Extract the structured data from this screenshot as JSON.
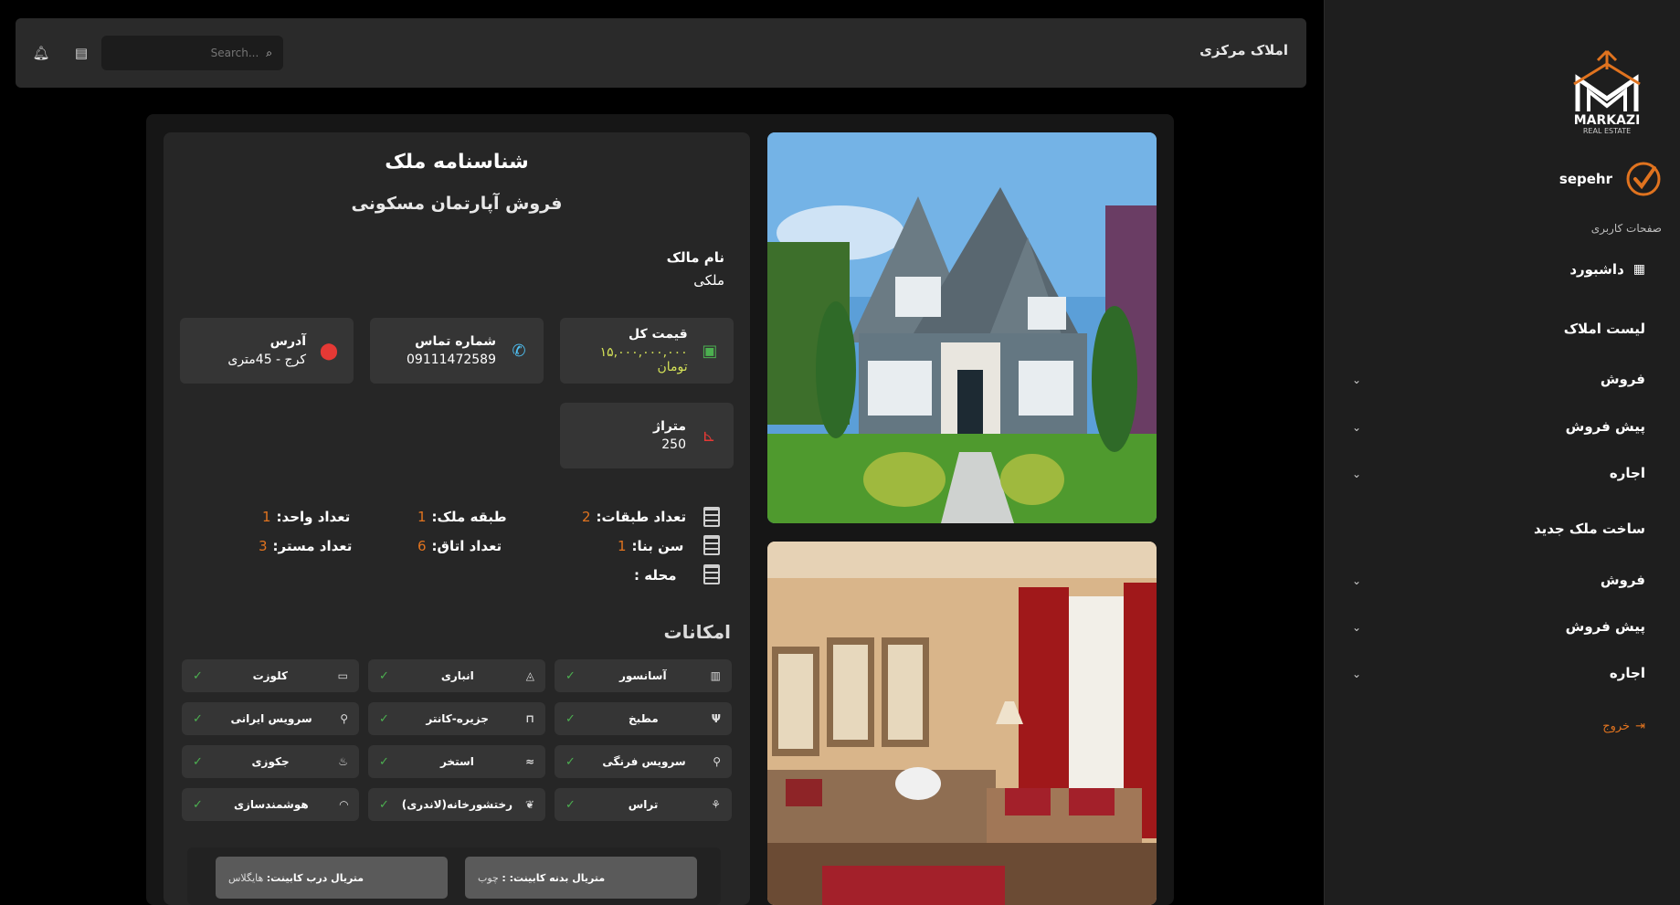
{
  "app": {
    "title": "املاک مرکزی"
  },
  "search": {
    "placeholder": "Search..."
  },
  "sidebar": {
    "user_name": "sepehr",
    "section_title": "صفحات کاربری",
    "dashboard": "داشبورد",
    "items": [
      {
        "label": "لیست املاک"
      },
      {
        "label": "فروش"
      },
      {
        "label": "پیش فروش"
      },
      {
        "label": "اجاره"
      },
      {
        "label": "ساخت ملک جدید"
      },
      {
        "label": "فروش"
      },
      {
        "label": "پیش فروش"
      },
      {
        "label": "اجاره"
      }
    ],
    "logout": "خروج"
  },
  "logo": {
    "line1": "MARKAZI",
    "line2": "REAL ESTATE"
  },
  "property": {
    "title": "شناسنامه ملک",
    "subtitle": "فروش آپارتمان مسکونی",
    "owner_label": "نام مالک",
    "owner_value": "ملکی",
    "price_label": "قیمت کل",
    "price_value": "۱۵,۰۰۰,۰۰۰,۰۰۰ تومان",
    "phone_label": "شماره تماس",
    "phone_value": "09111472589",
    "address_label": "آدرس",
    "address_value": "کرج - 45متری",
    "area_label": "متراژ",
    "area_value": "250",
    "stats": {
      "floors_label": "تعداد طبقات:",
      "floors": "2",
      "floor_label": "طبقه ملک:",
      "floor": "1",
      "units_label": "تعداد واحد:",
      "units": "1",
      "age_label": "سن بنا:",
      "age": "1",
      "rooms_label": "تعداد اتاق:",
      "rooms": "6",
      "maid_label": "تعداد مستر:",
      "maid": "3",
      "district_label": "محله :"
    },
    "amenities_title": "امکانات",
    "amenities": [
      {
        "label": "آسانسور",
        "icon": "building-icon"
      },
      {
        "label": "انباری",
        "icon": "warehouse-icon"
      },
      {
        "label": "کلوزت",
        "icon": "closet-icon"
      },
      {
        "label": "مطبخ",
        "icon": "kitchen-icon"
      },
      {
        "label": "جزیره-کانتر",
        "icon": "counter-icon"
      },
      {
        "label": "سرویس ایرانی",
        "icon": "wc-icon"
      },
      {
        "label": "سرویس فرنگی",
        "icon": "wc-icon"
      },
      {
        "label": "استخر",
        "icon": "pool-icon"
      },
      {
        "label": "جکوزی",
        "icon": "jacuzzi-icon"
      },
      {
        "label": "تراس",
        "icon": "terrace-icon"
      },
      {
        "label": "رختشورخانه(لاندری)",
        "icon": "laundry-icon"
      },
      {
        "label": "هوشمندسازی",
        "icon": "wifi-icon"
      }
    ],
    "cabinet_body_label": "متریال بدنه کابینت: :",
    "cabinet_body_value": "چوب",
    "cabinet_door_label": "متریال درب کابینت:",
    "cabinet_door_value": "هایگلاس"
  },
  "colors": {
    "accent": "#e0731f",
    "price": "#d4e157",
    "check": "#4caf50"
  }
}
